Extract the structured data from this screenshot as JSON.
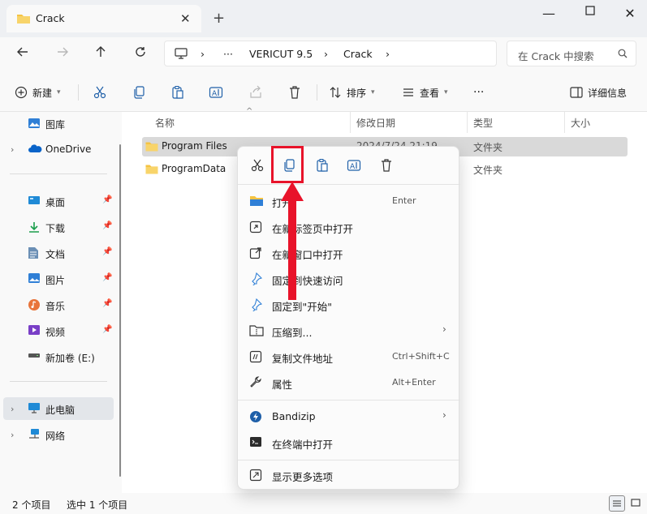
{
  "window": {
    "tab_title": "Crack",
    "tab_close": "✕",
    "new_tab": "+",
    "minimize": "—",
    "maximize": "☐",
    "close": "✕"
  },
  "address": {
    "more": "···",
    "crumbs": [
      "VERICUT 9.5",
      "Crack"
    ],
    "separator": "›",
    "search_placeholder": "在 Crack 中搜索"
  },
  "toolbar": {
    "new_label": "新建",
    "sort_label": "排序",
    "view_label": "查看",
    "more": "···",
    "details_label": "详细信息"
  },
  "sidebar": {
    "top_items": [
      {
        "label": "图库",
        "icon": "gallery-icon"
      },
      {
        "label": "OneDrive",
        "icon": "onedrive-icon"
      }
    ],
    "quick_access": [
      {
        "label": "桌面",
        "icon": "desktop-icon"
      },
      {
        "label": "下载",
        "icon": "download-icon"
      },
      {
        "label": "文档",
        "icon": "document-icon"
      },
      {
        "label": "图片",
        "icon": "picture-icon"
      },
      {
        "label": "音乐",
        "icon": "music-icon"
      },
      {
        "label": "视频",
        "icon": "video-icon"
      },
      {
        "label": "新加卷 (E:)",
        "icon": "drive-icon"
      }
    ],
    "bottom_items": [
      {
        "label": "此电脑",
        "icon": "this-pc-icon"
      },
      {
        "label": "网络",
        "icon": "network-icon"
      }
    ]
  },
  "columns": {
    "name": "名称",
    "date": "修改日期",
    "type": "类型",
    "size": "大小"
  },
  "files": [
    {
      "name": "Program Files",
      "date": "2024/7/24 21:19",
      "type": "文件夹",
      "selected": true
    },
    {
      "name": "ProgramData",
      "date": "",
      "type": "文件夹",
      "selected": false
    }
  ],
  "status": {
    "item_count": "2 个项目",
    "selected_count": "选中 1 个项目"
  },
  "context_menu": {
    "top_icons": [
      "cut-icon",
      "copy-icon",
      "paste-icon",
      "rename-icon",
      "delete-icon"
    ],
    "items": [
      {
        "label": "打开",
        "shortcut": "Enter",
        "icon": "folder-open-icon"
      },
      {
        "label": "在新标签页中打开",
        "shortcut": "",
        "icon": "new-tab-icon"
      },
      {
        "label": "在新窗口中打开",
        "shortcut": "",
        "icon": "new-window-icon"
      },
      {
        "label": "固定到快速访问",
        "shortcut": "",
        "icon": "pin-icon"
      },
      {
        "label": "固定到\"开始\"",
        "shortcut": "",
        "icon": "pin-start-icon"
      },
      {
        "label": "压缩到...",
        "shortcut": "",
        "icon": "compress-icon",
        "submenu": true
      },
      {
        "label": "复制文件地址",
        "shortcut": "Ctrl+Shift+C",
        "icon": "copy-path-icon"
      },
      {
        "label": "属性",
        "shortcut": "Alt+Enter",
        "icon": "properties-icon"
      },
      {
        "label": "Bandizip",
        "shortcut": "",
        "icon": "bandizip-icon",
        "submenu": true
      },
      {
        "label": "在终端中打开",
        "shortcut": "",
        "icon": "terminal-icon"
      },
      {
        "label": "显示更多选项",
        "shortcut": "",
        "icon": "more-options-icon"
      }
    ],
    "submenu_arrow": "›"
  },
  "colors": {
    "folder": "#f5c342",
    "accent_red": "#e8132a",
    "selection": "#d9d9d9",
    "onedrive": "#0a64c9"
  }
}
